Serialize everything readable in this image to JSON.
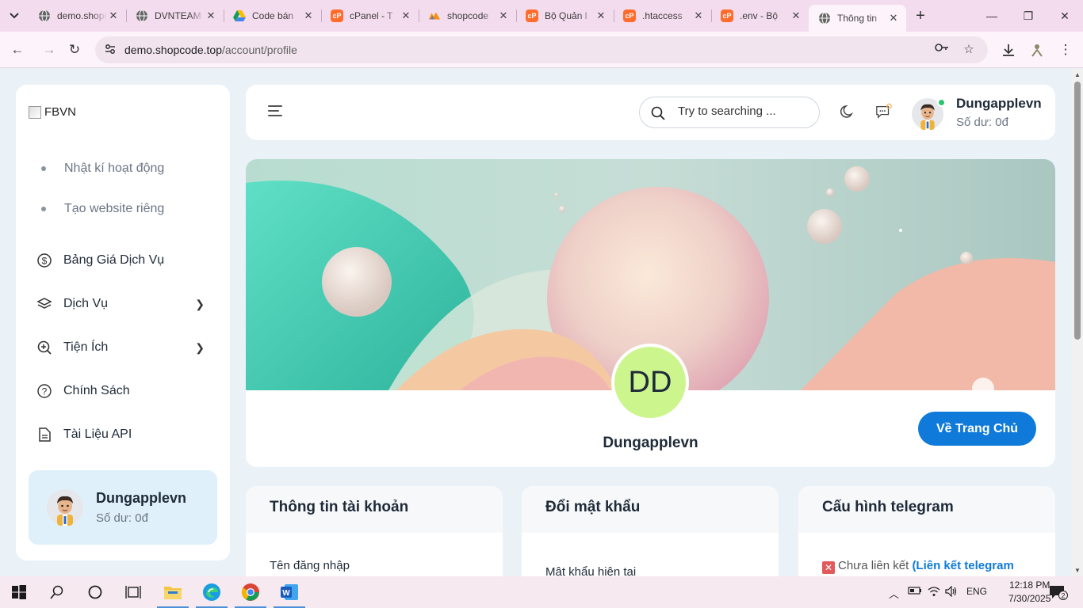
{
  "browser": {
    "tabs": [
      {
        "title": "demo.shopcode.top",
        "icon": "globe-icon",
        "active": false
      },
      {
        "title": "DVNTEAM",
        "icon": "globe-icon",
        "active": false
      },
      {
        "title": "Code bán",
        "icon": "google-drive-icon",
        "active": false
      },
      {
        "title": "cPanel - T",
        "icon": "cpanel-icon",
        "active": false
      },
      {
        "title": "shopcode",
        "icon": "phpmyadmin-icon",
        "active": false
      },
      {
        "title": "Bộ Quản l",
        "icon": "cpanel-icon",
        "active": false
      },
      {
        "title": ".htaccess",
        "icon": "cpanel-icon",
        "active": false
      },
      {
        "title": ".env - Bộ",
        "icon": "cpanel-icon",
        "active": false
      },
      {
        "title": "Thông tin",
        "icon": "globe-icon",
        "active": true
      }
    ],
    "url_host": "demo.shopcode.top",
    "url_path": "/account/profile"
  },
  "sidebar": {
    "logo_alt": "FBVN",
    "sub_items": [
      {
        "label": "Nhật kí hoạt động"
      },
      {
        "label": "Tạo website riêng"
      }
    ],
    "menu": [
      {
        "label": "Bảng Giá Dịch Vụ",
        "icon": "dollar-circle-icon",
        "has_children": false
      },
      {
        "label": "Dịch Vụ",
        "icon": "layers-icon",
        "has_children": true
      },
      {
        "label": "Tiện Ích",
        "icon": "zoom-plus-icon",
        "has_children": true
      },
      {
        "label": "Chính Sách",
        "icon": "help-circle-icon",
        "has_children": false
      },
      {
        "label": "Tài Liệu API",
        "icon": "document-icon",
        "has_children": false
      }
    ],
    "user": {
      "name": "Dungapplevn",
      "balance": "Số dư: 0đ"
    }
  },
  "header": {
    "search_placeholder": "Try to searching ...",
    "user": {
      "name": "Dungapplevn",
      "balance": "Số dư: 0đ",
      "online": true
    }
  },
  "profile": {
    "initials": "DD",
    "name": "Dungapplevn",
    "home_button": "Về Trang Chủ"
  },
  "cards": {
    "account": {
      "title": "Thông tin tài khoản",
      "field_label": "Tên đăng nhập"
    },
    "password": {
      "title": "Đổi mật khẩu",
      "field_label": "Mật khẩu hiện tại"
    },
    "telegram": {
      "title": "Cấu hình telegram",
      "status": "Chưa liên kết",
      "link_text": "(Liên kết telegram"
    }
  },
  "taskbar": {
    "language": "ENG",
    "time": "12:18 PM",
    "date": "7/30/2025",
    "notifications": "2"
  },
  "colors": {
    "primary": "#0f7ad9",
    "avatar_bg": "#cdf58e",
    "online": "#28c76f",
    "sidebar_user_bg": "#dff0fb"
  }
}
